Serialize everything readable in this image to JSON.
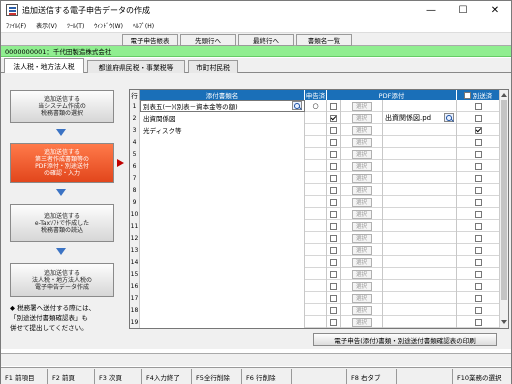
{
  "window": {
    "title": "追加送信する電子申告データの作成",
    "minimize": "—",
    "maximize": "☐",
    "close": "✕"
  },
  "menu": [
    {
      "label": "ﾌｧｲﾙ(F)"
    },
    {
      "label": "表示(V)"
    },
    {
      "label": "ﾂｰﾙ(T)"
    },
    {
      "label": "ｳｨﾝﾄﾞｳ(W)"
    },
    {
      "label": "ﾍﾙﾌﾟ(H)"
    }
  ],
  "toolbar": {
    "forms": "電子申告帳表",
    "first_row": "先頭行へ",
    "last_row": "最終行へ",
    "doc_list": "書類名一覧"
  },
  "company": "0000000001：千代田製造株式会社",
  "tabs": [
    "法人税・地方法人税",
    "都道府県民税・事業税等",
    "市町村民税"
  ],
  "steps": [
    "追加送信する\n当システム作成の\n税務書類の選択",
    "追加送信する\n第三者作成書類等の\nPDF添付・別途送付\nの確認・入力",
    "追加送信する\ne-Taxｿﾌﾄで作成した\n税務書類の読込",
    "追加送信する\n法人税・地方法人税の\n電子申告データ作成"
  ],
  "note": "◆ 税務署へ送付する際には、\n「別途送付書類確認表」も\n併せて提出してください。",
  "grid": {
    "headers": {
      "row": "行",
      "name": "添付書類名",
      "filed": "申告済",
      "pdf": "PDF添付",
      "separate": "別送済"
    },
    "select_label": "選択",
    "rows": [
      {
        "no": "1",
        "name": "別表五(一)(別表－資本金等の額)",
        "mag": true,
        "filed": "○",
        "pdf_check": false,
        "pdf_name": "",
        "pdf_mag": false,
        "sep": false
      },
      {
        "no": "2",
        "name": "出資関係図",
        "mag": false,
        "filed": "",
        "pdf_check": true,
        "pdf_name": "出資関係図.pd",
        "pdf_mag": true,
        "sep": false
      },
      {
        "no": "3",
        "name": "光ディスク等",
        "mag": false,
        "filed": "",
        "pdf_check": false,
        "pdf_name": "",
        "pdf_mag": false,
        "sep": true
      },
      {
        "no": "4",
        "name": "",
        "mag": false,
        "filed": "",
        "pdf_check": false,
        "pdf_name": "",
        "pdf_mag": false,
        "sep": false
      },
      {
        "no": "5",
        "name": "",
        "mag": false,
        "filed": "",
        "pdf_check": false,
        "pdf_name": "",
        "pdf_mag": false,
        "sep": false
      },
      {
        "no": "6",
        "name": "",
        "mag": false,
        "filed": "",
        "pdf_check": false,
        "pdf_name": "",
        "pdf_mag": false,
        "sep": false
      },
      {
        "no": "7",
        "name": "",
        "mag": false,
        "filed": "",
        "pdf_check": false,
        "pdf_name": "",
        "pdf_mag": false,
        "sep": false
      },
      {
        "no": "8",
        "name": "",
        "mag": false,
        "filed": "",
        "pdf_check": false,
        "pdf_name": "",
        "pdf_mag": false,
        "sep": false
      },
      {
        "no": "9",
        "name": "",
        "mag": false,
        "filed": "",
        "pdf_check": false,
        "pdf_name": "",
        "pdf_mag": false,
        "sep": false
      },
      {
        "no": "10",
        "name": "",
        "mag": false,
        "filed": "",
        "pdf_check": false,
        "pdf_name": "",
        "pdf_mag": false,
        "sep": false
      },
      {
        "no": "11",
        "name": "",
        "mag": false,
        "filed": "",
        "pdf_check": false,
        "pdf_name": "",
        "pdf_mag": false,
        "sep": false
      },
      {
        "no": "12",
        "name": "",
        "mag": false,
        "filed": "",
        "pdf_check": false,
        "pdf_name": "",
        "pdf_mag": false,
        "sep": false
      },
      {
        "no": "13",
        "name": "",
        "mag": false,
        "filed": "",
        "pdf_check": false,
        "pdf_name": "",
        "pdf_mag": false,
        "sep": false
      },
      {
        "no": "14",
        "name": "",
        "mag": false,
        "filed": "",
        "pdf_check": false,
        "pdf_name": "",
        "pdf_mag": false,
        "sep": false
      },
      {
        "no": "15",
        "name": "",
        "mag": false,
        "filed": "",
        "pdf_check": false,
        "pdf_name": "",
        "pdf_mag": false,
        "sep": false
      },
      {
        "no": "16",
        "name": "",
        "mag": false,
        "filed": "",
        "pdf_check": false,
        "pdf_name": "",
        "pdf_mag": false,
        "sep": false
      },
      {
        "no": "17",
        "name": "",
        "mag": false,
        "filed": "",
        "pdf_check": false,
        "pdf_name": "",
        "pdf_mag": false,
        "sep": false
      },
      {
        "no": "18",
        "name": "",
        "mag": false,
        "filed": "",
        "pdf_check": false,
        "pdf_name": "",
        "pdf_mag": false,
        "sep": false
      },
      {
        "no": "19",
        "name": "",
        "mag": false,
        "filed": "",
        "pdf_check": false,
        "pdf_name": "",
        "pdf_mag": false,
        "sep": false
      }
    ]
  },
  "print_button": "電子申告(添付)書類・別途送付書類確認表の印刷",
  "fkeys": [
    "F1 前項目",
    "F2 前頁",
    "F3 次頁",
    "F4入力終了",
    "F5全行削除",
    "F6 行削除",
    "",
    "F8 右タブ",
    "",
    "F10業務の選択"
  ],
  "colors": {
    "accent": "#1a6fb8",
    "company_bar": "#90ee90",
    "active_step": "#e2461c",
    "pointer": "#c00000"
  }
}
